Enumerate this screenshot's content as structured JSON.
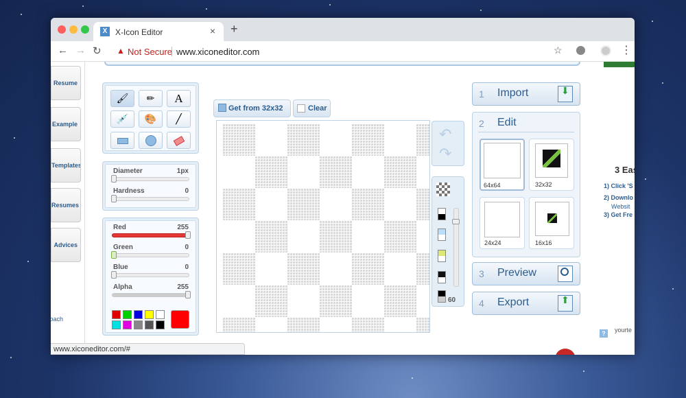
{
  "browser": {
    "tab_title": "X-Icon Editor",
    "tab_icon": "x-icon-editor-favicon",
    "security_text": "Not Secure",
    "url": "www.xiconeditor.com",
    "status_url": "www.xiconeditor.com/#"
  },
  "sidebar": {
    "items": [
      "Resume",
      "Example",
      "Templates",
      "Resumes",
      "Advices"
    ],
    "footer": "Coach"
  },
  "tools": [
    "brush-icon",
    "pencil-icon",
    "text-icon",
    "eyedropper-icon",
    "fill-icon",
    "line-icon",
    "rectangle-icon",
    "ellipse-icon",
    "eraser-icon"
  ],
  "text_tool_glyph": "A",
  "brush": {
    "diameter_label": "Diameter",
    "diameter_value": "1px",
    "hardness_label": "Hardness",
    "hardness_value": "0"
  },
  "color": {
    "red_label": "Red",
    "red_value": "255",
    "green_label": "Green",
    "green_value": "0",
    "blue_label": "Blue",
    "blue_value": "0",
    "alpha_label": "Alpha",
    "alpha_value": "255",
    "swatches": [
      "#e00000",
      "#00d000",
      "#0000e0",
      "#ffff00",
      "#ffffff",
      "#00e0e0",
      "#e000e0",
      "#888888",
      "#555555",
      "#000000"
    ],
    "current": "#ff0000"
  },
  "canvas_toolbar": {
    "get_label": "Get from 32x32",
    "clear_label": "Clear"
  },
  "zoom": {
    "value": "60"
  },
  "steps": {
    "import": {
      "num": "1",
      "label": "Import"
    },
    "edit": {
      "num": "2",
      "label": "Edit"
    },
    "preview": {
      "num": "3",
      "label": "Preview"
    },
    "export": {
      "num": "4",
      "label": "Export"
    }
  },
  "sizes": [
    "64x64",
    "32x32",
    "24x24",
    "16x16"
  ],
  "right_partial": {
    "heading": "3 Eas",
    "step1": "1) Click 'S",
    "step2": "2) Downlo",
    "step2b": "Websit",
    "step3": "3) Get Fre",
    "footer": "yourte"
  }
}
